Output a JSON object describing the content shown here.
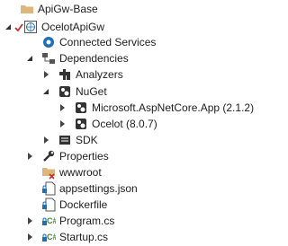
{
  "tree": {
    "solution_name": "ApiGw-Base",
    "project_name": "OcelotApiGw",
    "connected_services": "Connected Services",
    "dependencies": "Dependencies",
    "analyzers": "Analyzers",
    "nuget": "NuGet",
    "pkg_aspnetcore": "Microsoft.AspNetCore.App (2.1.2)",
    "pkg_ocelot": "Ocelot (8.0.7)",
    "sdk": "SDK",
    "properties": "Properties",
    "wwwroot": "wwwroot",
    "appsettings": "appsettings.json",
    "dockerfile": "Dockerfile",
    "program": "Program.cs",
    "startup": "Startup.cs"
  },
  "colors": {
    "folder": "#dcb67a",
    "check": "#c53030",
    "csharp": "#388a34",
    "lock": "#1e6fb5"
  }
}
